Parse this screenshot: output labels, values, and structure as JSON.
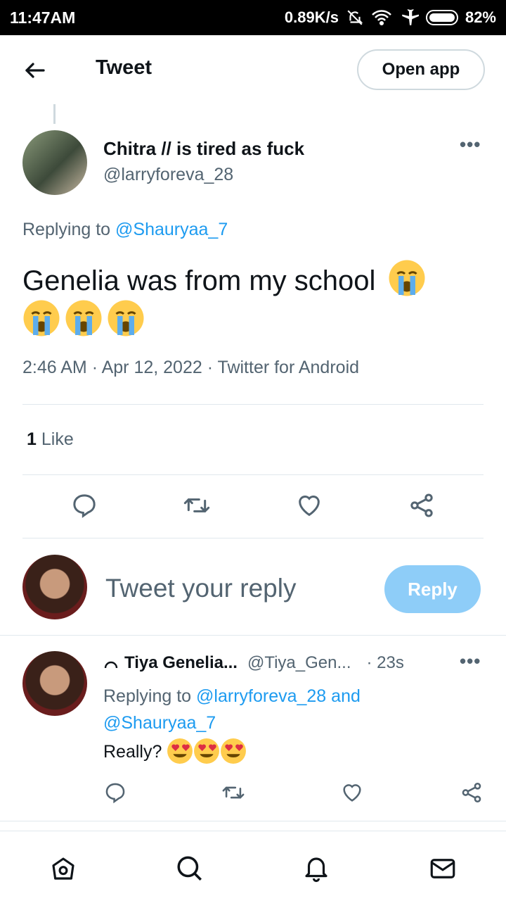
{
  "status_bar": {
    "time": "11:47AM",
    "speed": "0.89K/s",
    "battery": "82%"
  },
  "header": {
    "title": "Tweet",
    "open_app_label": "Open app"
  },
  "tweet": {
    "author_name": "Chitra // is tired as fuck",
    "author_handle": "@larryforeva_28",
    "replying_prefix": "Replying to",
    "replying_to": "@Shauryaa_7",
    "text": "Genelia was from my school",
    "emoji": "loudly-crying-face",
    "emoji_count": 4,
    "time": "2:46 AM",
    "date": "Apr 12, 2022",
    "source": "Twitter for Android",
    "like_count": "1",
    "like_label": "Like"
  },
  "composer": {
    "placeholder": "Tweet your reply",
    "reply_button": "Reply"
  },
  "reply": {
    "name": "Tiya Genelia...",
    "handle": "@Tiya_Gen...",
    "time": "· 23s",
    "replying_prefix": "Replying to",
    "replying_to_1": "@larryforeva_28",
    "replying_and": "and",
    "replying_to_2": "@Shauryaa_7",
    "text": "Really?",
    "emoji": "smiling-face-with-heart-eyes",
    "emoji_count": 3
  },
  "colors": {
    "accent": "#1d9bf0",
    "reply_button_bg": "#8ecdf8",
    "muted_text": "#536471",
    "divider": "#e1e8ed"
  },
  "icons": [
    "back-arrow-icon",
    "more-icon",
    "comment-icon",
    "retweet-icon",
    "heart-icon",
    "share-icon",
    "home-icon",
    "search-icon",
    "bell-icon",
    "mail-icon"
  ]
}
